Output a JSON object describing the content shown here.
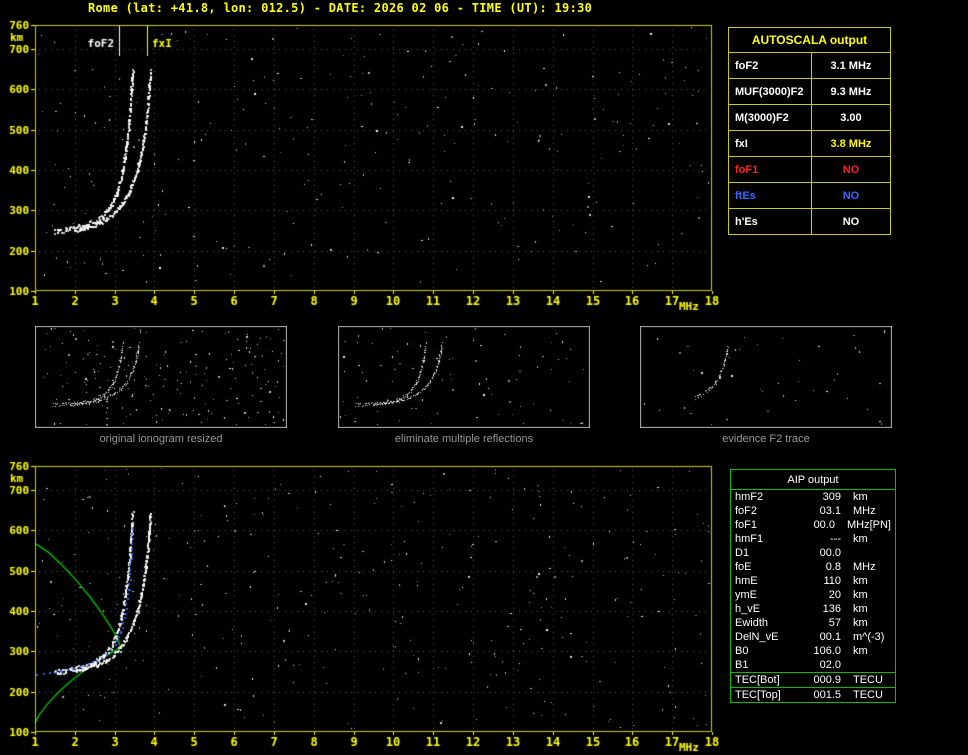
{
  "title": "Rome (lat: +41.8, lon: 012.5) - DATE: 2026 02 06 - TIME (UT): 19:30",
  "colors": {
    "background": "#000000",
    "accent_yellow": "#ffff00",
    "accent_green": "#00c000",
    "accent_red": "#ff2020",
    "accent_blue": "#2e6bff",
    "caption_gray": "#989898"
  },
  "autoscala_table": {
    "header": "AUTOSCALA output",
    "rows": [
      {
        "label": "foF2",
        "value": "3.1 MHz",
        "label_color": "#ffffff",
        "value_color": "#ffffff"
      },
      {
        "label": "MUF(3000)F2",
        "value": "9.3 MHz",
        "label_color": "#ffffff",
        "value_color": "#ffffff"
      },
      {
        "label": "M(3000)F2",
        "value": "3.00",
        "label_color": "#ffffff",
        "value_color": "#ffffff"
      },
      {
        "label": "fxI",
        "value": "3.8 MHz",
        "label_color": "#ffffff",
        "value_color": "#ffff00"
      },
      {
        "label": "foF1",
        "value": "NO",
        "label_color": "#ff2020",
        "value_color": "#ff2020"
      },
      {
        "label": "ftEs",
        "value": "NO",
        "label_color": "#2e6bff",
        "value_color": "#2e6bff"
      },
      {
        "label": "h'Es",
        "value": "NO",
        "label_color": "#ffffff",
        "value_color": "#ffffff"
      }
    ]
  },
  "panel_captions": [
    "original ionogram resized",
    "eliminate multiple reflections",
    "evidence F2 trace"
  ],
  "aip_table": {
    "header": "AIP output",
    "rows": [
      {
        "label": "hmF2",
        "value": "309",
        "unit": "km"
      },
      {
        "label": "foF2",
        "value": "03.1",
        "unit": "MHz"
      },
      {
        "label": "foF1",
        "value": "00.0",
        "unit": "MHz",
        "note": "[PN]"
      },
      {
        "label": "hmF1",
        "value": "---",
        "unit": "km"
      },
      {
        "label": "D1",
        "value": "00.0",
        "unit": ""
      },
      {
        "label": "foE",
        "value": "0.8",
        "unit": "MHz"
      },
      {
        "label": "hmE",
        "value": "110",
        "unit": "km"
      },
      {
        "label": "ymE",
        "value": "20",
        "unit": "km"
      },
      {
        "label": "h_vE",
        "value": "136",
        "unit": "km"
      },
      {
        "label": "Ewidth",
        "value": "57",
        "unit": "km"
      },
      {
        "label": "DelN_vE",
        "value": "00.1",
        "unit": "m^(-3)"
      },
      {
        "label": "B0",
        "value": "106.0",
        "unit": "km"
      },
      {
        "label": "B1",
        "value": "02.0",
        "unit": ""
      },
      {
        "label": "TEC[Bot]",
        "value": "000.9",
        "unit": "TECU",
        "sep": true
      },
      {
        "label": "TEC[Top]",
        "value": "001.5",
        "unit": "TECU",
        "sep": true
      }
    ]
  },
  "chart_data": [
    {
      "id": "main_ionogram",
      "type": "scatter",
      "title": "",
      "xlabel": "MHz",
      "ylabel": "km",
      "x_range": [
        1,
        18
      ],
      "y_range": [
        100,
        760
      ],
      "x_ticks": [
        1,
        2,
        3,
        4,
        5,
        6,
        7,
        8,
        9,
        10,
        11,
        12,
        13,
        14,
        15,
        16,
        17,
        18
      ],
      "y_ticks": [
        760,
        700,
        600,
        500,
        400,
        300,
        200,
        100
      ],
      "grid": true,
      "axes": true,
      "legend": "none",
      "border_color": "#cccc00",
      "axis_color": "#ffff00",
      "margins": {
        "l": 35,
        "t": 11,
        "r": 13,
        "b": 23
      },
      "markers": [
        {
          "label": "foF2",
          "freq_mhz": 3.1,
          "color": "#ffffff",
          "label_side": "left"
        },
        {
          "label": "fxI",
          "freq_mhz": 3.8,
          "color": "#ffff00",
          "label_side": "right"
        }
      ],
      "series": [
        {
          "name": "O-trace",
          "color": "#ffffff",
          "style": "echo",
          "thickness": 5,
          "dot": 2,
          "points": [
            [
              1.5,
              248
            ],
            [
              1.75,
              251
            ],
            [
              2.0,
              256
            ],
            [
              2.25,
              263
            ],
            [
              2.5,
              273
            ],
            [
              2.7,
              288
            ],
            [
              2.9,
              310
            ],
            [
              3.05,
              342
            ],
            [
              3.18,
              388
            ],
            [
              3.28,
              448
            ],
            [
              3.36,
              520
            ],
            [
              3.42,
              595
            ],
            [
              3.45,
              645
            ]
          ]
        },
        {
          "name": "X-trace",
          "color": "#ffffff",
          "style": "echo",
          "thickness": 4,
          "dot": 2,
          "points": [
            [
              2.05,
              252
            ],
            [
              2.3,
              258
            ],
            [
              2.55,
              266
            ],
            [
              2.8,
              278
            ],
            [
              3.0,
              294
            ],
            [
              3.2,
              318
            ],
            [
              3.4,
              352
            ],
            [
              3.57,
              398
            ],
            [
              3.7,
              455
            ],
            [
              3.8,
              525
            ],
            [
              3.87,
              600
            ],
            [
              3.9,
              645
            ]
          ]
        }
      ],
      "noise": {
        "seed": 7,
        "count": 270
      }
    },
    {
      "id": "panel_original",
      "type": "scatter",
      "title": "original ionogram resized",
      "x_range": [
        1,
        8
      ],
      "y_range": [
        100,
        760
      ],
      "grid": false,
      "axes": false,
      "border_color": "#b4b4b4",
      "margins": {
        "l": 0,
        "t": 0,
        "r": 0,
        "b": 0
      },
      "series": [
        {
          "name": "O-trace",
          "color": "#ffffff",
          "style": "echo",
          "thickness": 3,
          "dot": 1,
          "points": [
            [
              1.5,
              248
            ],
            [
              1.75,
              251
            ],
            [
              2.0,
              256
            ],
            [
              2.25,
              263
            ],
            [
              2.5,
              273
            ],
            [
              2.7,
              288
            ],
            [
              2.9,
              310
            ],
            [
              3.05,
              342
            ],
            [
              3.18,
              388
            ],
            [
              3.28,
              448
            ],
            [
              3.36,
              520
            ],
            [
              3.42,
              595
            ],
            [
              3.45,
              645
            ]
          ]
        },
        {
          "name": "X-trace",
          "color": "#ffffff",
          "style": "echo",
          "thickness": 3,
          "dot": 1,
          "points": [
            [
              2.05,
              252
            ],
            [
              2.3,
              258
            ],
            [
              2.55,
              266
            ],
            [
              2.8,
              278
            ],
            [
              3.0,
              294
            ],
            [
              3.2,
              318
            ],
            [
              3.4,
              352
            ],
            [
              3.57,
              398
            ],
            [
              3.7,
              455
            ],
            [
              3.8,
              525
            ],
            [
              3.87,
              600
            ],
            [
              3.9,
              645
            ]
          ]
        }
      ],
      "noise": {
        "seed": 11,
        "count": 200
      }
    },
    {
      "id": "panel_multiples",
      "type": "scatter",
      "title": "eliminate multiple reflections",
      "x_range": [
        1,
        8
      ],
      "y_range": [
        100,
        760
      ],
      "grid": false,
      "axes": false,
      "border_color": "#b4b4b4",
      "margins": {
        "l": 0,
        "t": 0,
        "r": 0,
        "b": 0
      },
      "series": [
        {
          "name": "O-trace",
          "color": "#ffffff",
          "style": "echo",
          "thickness": 3,
          "dot": 1,
          "points": [
            [
              1.5,
              248
            ],
            [
              1.75,
              251
            ],
            [
              2.0,
              256
            ],
            [
              2.25,
              263
            ],
            [
              2.5,
              273
            ],
            [
              2.7,
              288
            ],
            [
              2.9,
              310
            ],
            [
              3.05,
              342
            ],
            [
              3.18,
              388
            ],
            [
              3.28,
              448
            ],
            [
              3.36,
              520
            ],
            [
              3.42,
              595
            ],
            [
              3.45,
              645
            ]
          ]
        },
        {
          "name": "X-trace",
          "color": "#ffffff",
          "style": "echo",
          "thickness": 2,
          "dot": 1,
          "points": [
            [
              2.05,
              252
            ],
            [
              2.3,
              258
            ],
            [
              2.55,
              266
            ],
            [
              2.8,
              278
            ],
            [
              3.0,
              294
            ],
            [
              3.2,
              318
            ],
            [
              3.4,
              352
            ],
            [
              3.57,
              398
            ],
            [
              3.7,
              455
            ],
            [
              3.8,
              525
            ],
            [
              3.87,
              600
            ],
            [
              3.9,
              645
            ]
          ]
        }
      ],
      "noise": {
        "seed": 12,
        "count": 85
      }
    },
    {
      "id": "panel_f2",
      "type": "scatter",
      "title": "evidence F2 trace",
      "x_range": [
        1,
        8
      ],
      "y_range": [
        100,
        760
      ],
      "grid": false,
      "axes": false,
      "border_color": "#b4b4b4",
      "margins": {
        "l": 0,
        "t": 0,
        "r": 0,
        "b": 0
      },
      "series": [
        {
          "name": "F2-trace",
          "color": "#ffffff",
          "style": "echo",
          "thickness": 3,
          "dot": 1,
          "points": [
            [
              2.55,
              295
            ],
            [
              2.75,
              320
            ],
            [
              2.95,
              352
            ],
            [
              3.1,
              390
            ],
            [
              3.22,
              440
            ],
            [
              3.32,
              505
            ],
            [
              3.4,
              575
            ],
            [
              3.44,
              628
            ]
          ]
        }
      ],
      "noise": {
        "seed": 13,
        "count": 42
      }
    },
    {
      "id": "profile_plot",
      "type": "scatter",
      "title": "",
      "xlabel": "MHz",
      "ylabel": "km",
      "x_range": [
        1,
        18
      ],
      "y_range": [
        100,
        760
      ],
      "x_ticks": [
        1,
        2,
        3,
        4,
        5,
        6,
        7,
        8,
        9,
        10,
        11,
        12,
        13,
        14,
        15,
        16,
        17,
        18
      ],
      "y_ticks": [
        760,
        700,
        600,
        500,
        400,
        300,
        200,
        100
      ],
      "grid": true,
      "axes": true,
      "border_color": "#cccc00",
      "axis_color": "#ffff00",
      "margins": {
        "l": 35,
        "t": 11,
        "r": 13,
        "b": 23
      },
      "series": [
        {
          "name": "Ne-profile-bottomside",
          "color": "#00c000",
          "style": "line",
          "width": 1.4,
          "points": [
            [
              1.0,
              122
            ],
            [
              1.1,
              142
            ],
            [
              1.3,
              168
            ],
            [
              1.55,
              195
            ],
            [
              1.85,
              222
            ],
            [
              2.2,
              250
            ],
            [
              2.55,
              274
            ],
            [
              2.85,
              293
            ],
            [
              3.05,
              304
            ],
            [
              3.15,
              309
            ]
          ]
        },
        {
          "name": "Ne-profile-topside",
          "color": "#00c000",
          "style": "line",
          "width": 1.4,
          "points": [
            [
              3.15,
              309
            ],
            [
              3.08,
              330
            ],
            [
              2.92,
              358
            ],
            [
              2.68,
              395
            ],
            [
              2.38,
              435
            ],
            [
              2.05,
              475
            ],
            [
              1.7,
              512
            ],
            [
              1.35,
              545
            ],
            [
              1.05,
              565
            ],
            [
              1.0,
              568
            ]
          ]
        },
        {
          "name": "O-trace",
          "color": "#ffffff",
          "style": "echo",
          "thickness": 5,
          "dot": 2,
          "points": [
            [
              1.5,
              248
            ],
            [
              1.75,
              251
            ],
            [
              2.0,
              256
            ],
            [
              2.25,
              263
            ],
            [
              2.5,
              273
            ],
            [
              2.7,
              288
            ],
            [
              2.9,
              310
            ],
            [
              3.05,
              342
            ],
            [
              3.18,
              388
            ],
            [
              3.28,
              448
            ],
            [
              3.36,
              520
            ],
            [
              3.42,
              595
            ],
            [
              3.45,
              645
            ]
          ]
        },
        {
          "name": "X-trace",
          "color": "#ffffff",
          "style": "echo",
          "thickness": 3,
          "dot": 2,
          "points": [
            [
              2.05,
              252
            ],
            [
              2.3,
              258
            ],
            [
              2.55,
              266
            ],
            [
              2.8,
              278
            ],
            [
              3.0,
              294
            ],
            [
              3.2,
              318
            ],
            [
              3.4,
              352
            ],
            [
              3.57,
              398
            ],
            [
              3.7,
              455
            ],
            [
              3.8,
              525
            ],
            [
              3.87,
              600
            ],
            [
              3.9,
              645
            ]
          ]
        },
        {
          "name": "restored-trace",
          "color": "#2e6bff",
          "style": "dots",
          "thickness": 1,
          "dot": 2,
          "points": [
            [
              1.05,
              242
            ],
            [
              1.35,
              246
            ],
            [
              1.65,
              251
            ],
            [
              1.95,
              257
            ],
            [
              2.25,
              265
            ],
            [
              2.55,
              277
            ],
            [
              2.8,
              293
            ],
            [
              3.0,
              316
            ],
            [
              3.15,
              348
            ],
            [
              3.27,
              395
            ],
            [
              3.35,
              455
            ],
            [
              3.41,
              530
            ],
            [
              3.45,
              605
            ]
          ]
        }
      ],
      "noise": {
        "seed": 21,
        "count": 340
      }
    }
  ]
}
